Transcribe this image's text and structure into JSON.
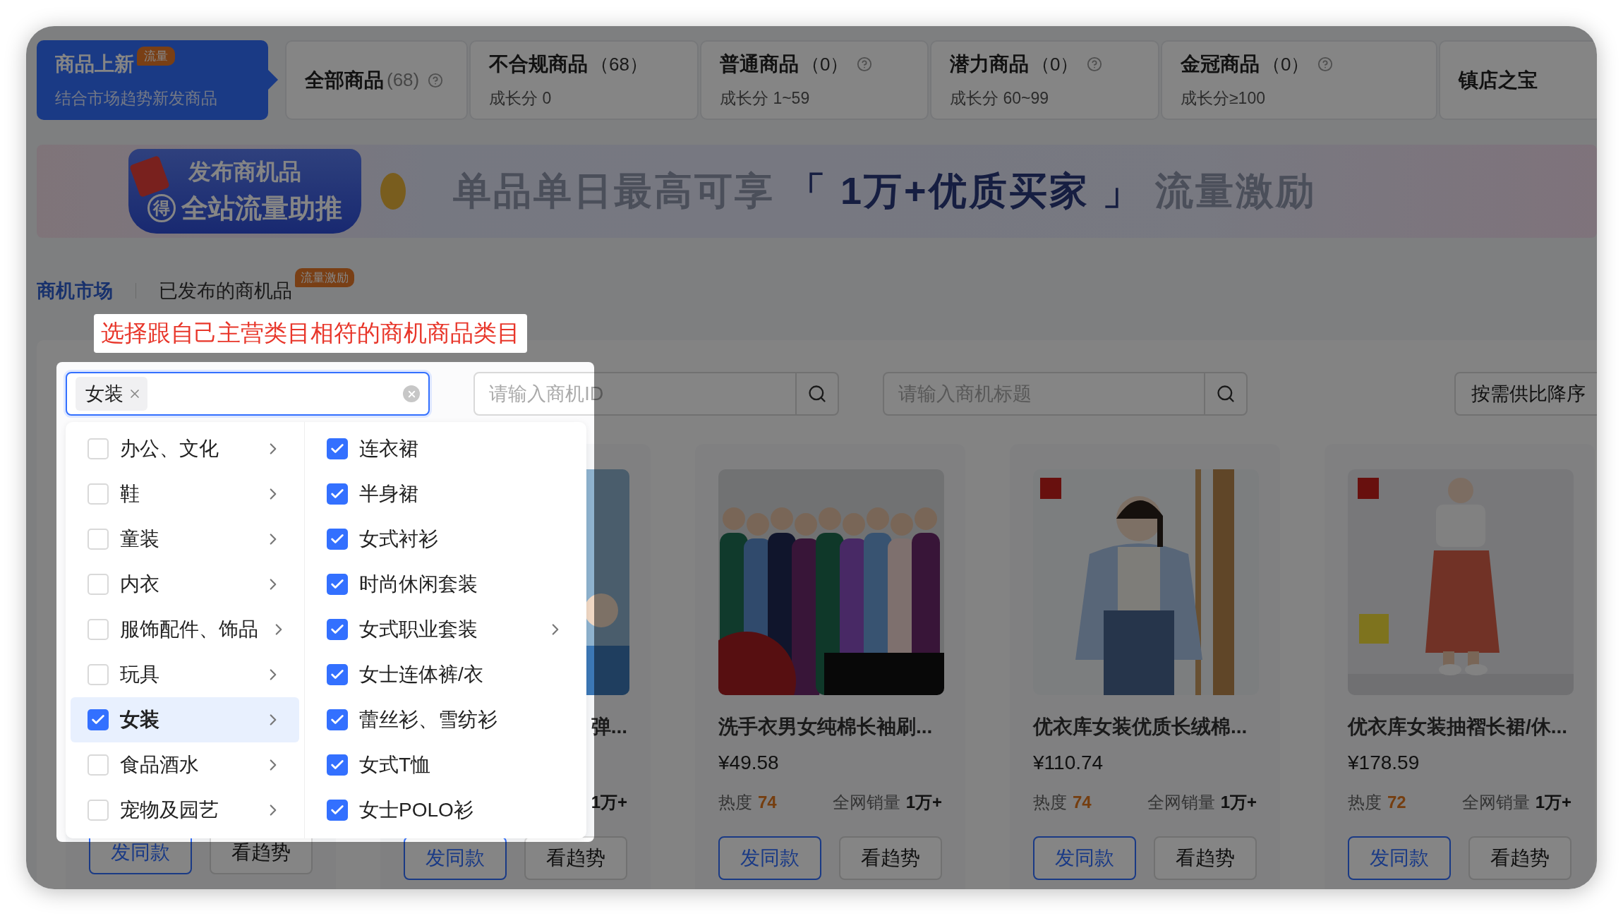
{
  "tabs": [
    {
      "title": "商品上新",
      "badge": "流量",
      "subtitle": "结合市场趋势新发商品",
      "selected": true
    },
    {
      "title": "全部商品",
      "count": "(68)",
      "help": true,
      "selected": false
    },
    {
      "title": "不合规商品",
      "count": "（68）",
      "help": false,
      "subtitle": "成长分 0",
      "selected": false
    },
    {
      "title": "普通商品",
      "count": "（0）",
      "help": true,
      "subtitle": "成长分 1~59",
      "selected": false
    },
    {
      "title": "潜力商品",
      "count": "（0）",
      "help": true,
      "subtitle": "成长分 60~99",
      "selected": false
    },
    {
      "title": "金冠商品",
      "count": "（0）",
      "help": true,
      "subtitle": "成长分≥100",
      "selected": false
    },
    {
      "title": "镇店之宝",
      "selected": false
    }
  ],
  "banner": {
    "badge_line_1": "发布商机品",
    "badge_mark": "得",
    "badge_line_2": "全站流量助推",
    "headline": [
      {
        "text": "单品单日最高可享 ",
        "emphasis": false
      },
      {
        "text": "「 ",
        "emphasis": true
      },
      {
        "text": "1万+优质买家",
        "emphasis": true
      },
      {
        "text": " 」",
        "emphasis": true
      },
      {
        "text": " 流量激励",
        "emphasis": false
      }
    ]
  },
  "sub_tabs": [
    {
      "label": "商机市场",
      "selected": true
    },
    {
      "label": "已发布的商机品",
      "badge": "流量激励",
      "selected": false
    }
  ],
  "callout": "选择跟自己主营类目相符的商机商品类目",
  "filters": {
    "category": {
      "tags": [
        "女装"
      ]
    },
    "id_search": {
      "placeholder": "请输入商机ID"
    },
    "title_search": {
      "placeholder": "请输入商机标题"
    },
    "sort_button": "按需供比降序"
  },
  "category_menu": {
    "parents": [
      {
        "label": "办公、文化",
        "checked": false,
        "selected": false
      },
      {
        "label": "鞋",
        "checked": false,
        "selected": false
      },
      {
        "label": "童装",
        "checked": false,
        "selected": false
      },
      {
        "label": "内衣",
        "checked": false,
        "selected": false
      },
      {
        "label": "服饰配件、饰品",
        "checked": false,
        "selected": false
      },
      {
        "label": "玩具",
        "checked": false,
        "selected": false
      },
      {
        "label": "女装",
        "checked": true,
        "selected": true
      },
      {
        "label": "食品酒水",
        "checked": false,
        "selected": false
      },
      {
        "label": "宠物及园艺",
        "checked": false,
        "selected": false
      }
    ],
    "children": [
      {
        "label": "连衣裙",
        "checked": true,
        "has_children": false
      },
      {
        "label": "半身裙",
        "checked": true,
        "has_children": false
      },
      {
        "label": "女式衬衫",
        "checked": true,
        "has_children": false
      },
      {
        "label": "时尚休闲套装",
        "checked": true,
        "has_children": false
      },
      {
        "label": "女式职业套装",
        "checked": true,
        "has_children": true
      },
      {
        "label": "女士连体裤/衣",
        "checked": true,
        "has_children": false
      },
      {
        "label": "蕾丝衫、雪纺衫",
        "checked": true,
        "has_children": false
      },
      {
        "label": "女式T恤",
        "checked": true,
        "has_children": false
      },
      {
        "label": "女士POLO衫",
        "checked": true,
        "has_children": false
      }
    ]
  },
  "cards": [
    {
      "buttons": [
        {
          "label": "发同款",
          "kind": "primary"
        },
        {
          "label": "看趋势",
          "kind": "default"
        }
      ]
    },
    {
      "title": "弹...",
      "sales": {
        "value": "1万+"
      },
      "buttons": [
        {
          "label": "发同款",
          "kind": "primary"
        },
        {
          "label": "看趋势",
          "kind": "default"
        }
      ]
    },
    {
      "title": "洗手衣男女纯棉长袖刷...",
      "price": "¥49.58",
      "heat": {
        "label": "热度",
        "value": "74"
      },
      "sales": {
        "label": "全网销量",
        "value": "1万+"
      },
      "buttons": [
        {
          "label": "发同款",
          "kind": "primary"
        },
        {
          "label": "看趋势",
          "kind": "default"
        }
      ]
    },
    {
      "title": "优衣库女装优质长绒棉...",
      "price": "¥110.74",
      "heat": {
        "label": "热度",
        "value": "74"
      },
      "sales": {
        "label": "全网销量",
        "value": "1万+"
      },
      "buttons": [
        {
          "label": "发同款",
          "kind": "primary"
        },
        {
          "label": "看趋势",
          "kind": "default"
        }
      ]
    },
    {
      "title": "优衣库女装抽褶长裙/休...",
      "price": "¥178.59",
      "heat": {
        "label": "热度",
        "value": "72"
      },
      "sales": {
        "label": "全网销量",
        "value": "1万+"
      },
      "buttons": [
        {
          "label": "发同款",
          "kind": "primary"
        },
        {
          "label": "看趋势",
          "kind": "default"
        }
      ]
    }
  ]
}
